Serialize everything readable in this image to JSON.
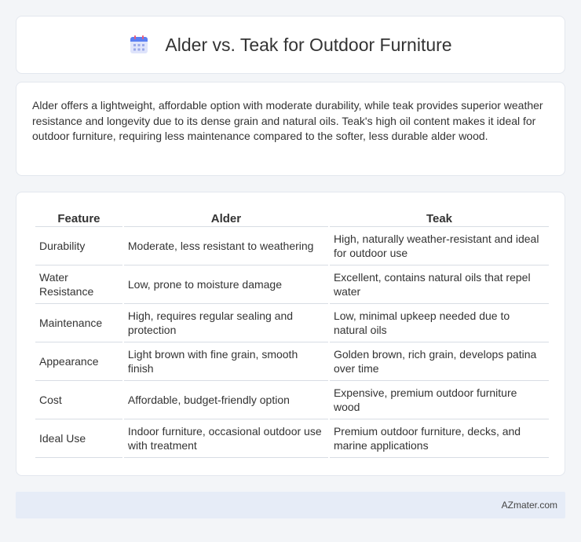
{
  "header": {
    "title": "Alder vs. Teak for Outdoor Furniture",
    "icon": "calendar-icon"
  },
  "summary": {
    "text": "Alder offers a lightweight, affordable option with moderate durability, while teak provides superior weather resistance and longevity due to its dense grain and natural oils. Teak's high oil content makes it ideal for outdoor furniture, requiring less maintenance compared to the softer, less durable alder wood."
  },
  "table": {
    "headers": [
      "Feature",
      "Alder",
      "Teak"
    ],
    "rows": [
      [
        "Durability",
        "Moderate, less resistant to weathering",
        "High, naturally weather-resistant and ideal for outdoor use"
      ],
      [
        "Water Resistance",
        "Low, prone to moisture damage",
        "Excellent, contains natural oils that repel water"
      ],
      [
        "Maintenance",
        "High, requires regular sealing and protection",
        "Low, minimal upkeep needed due to natural oils"
      ],
      [
        "Appearance",
        "Light brown with fine grain, smooth finish",
        "Golden brown, rich grain, develops patina over time"
      ],
      [
        "Cost",
        "Affordable, budget-friendly option",
        "Expensive, premium outdoor furniture wood"
      ],
      [
        "Ideal Use",
        "Indoor furniture, occasional outdoor use with treatment",
        "Premium outdoor furniture, decks, and marine applications"
      ]
    ]
  },
  "footer": {
    "brand": "AZmater.com"
  }
}
